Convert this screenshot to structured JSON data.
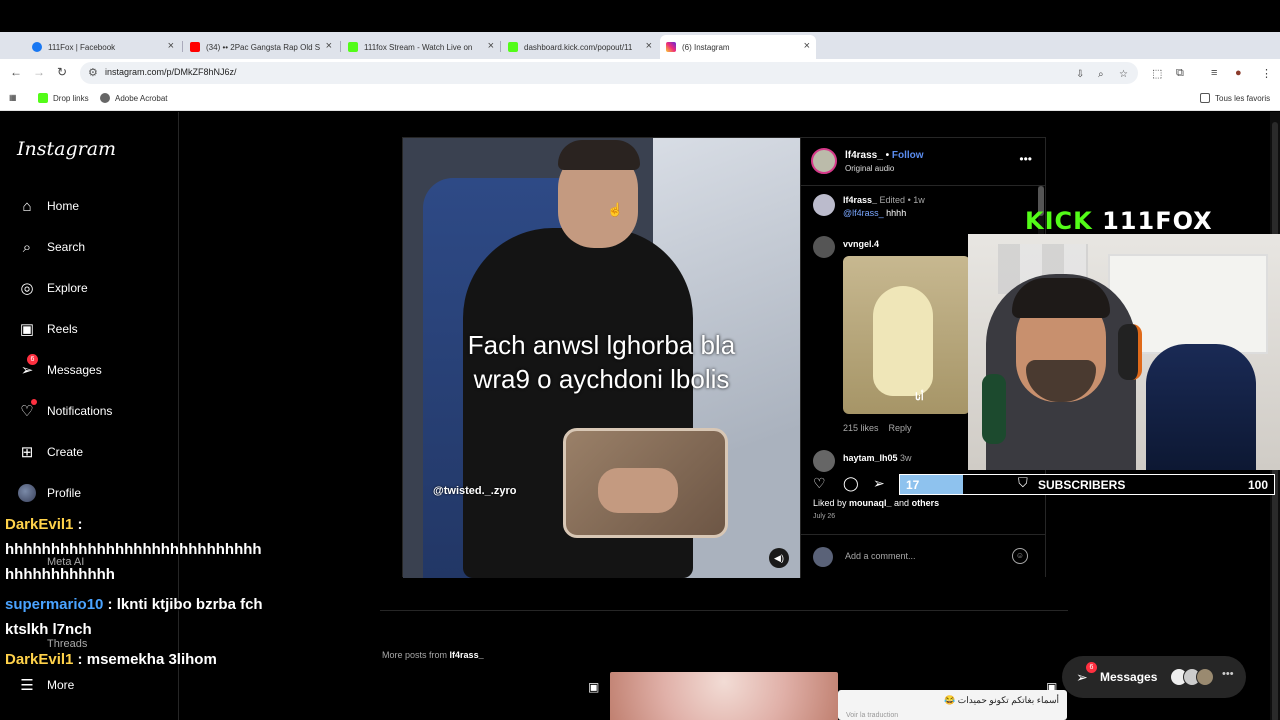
{
  "browser": {
    "tabs": [
      {
        "title": "111Fox | Facebook",
        "color": "#1877f2"
      },
      {
        "title": "(34) •• 2Pac Gangsta Rap Old S",
        "color": "#ff0000"
      },
      {
        "title": "111fox Stream - Watch Live on",
        "color": "#53fc18"
      },
      {
        "title": "dashboard.kick.com/popout/11",
        "color": "#53fc18"
      },
      {
        "title": "(6) Instagram",
        "color": "#d6249f"
      }
    ],
    "url": "instagram.com/p/DMkZF8hNJ6z/",
    "bookmarks": [
      {
        "label": "Drop links",
        "color": "#53fc18"
      },
      {
        "label": "Adobe Acrobat",
        "color": "#666666"
      }
    ],
    "all_bookmarks": "Tous les favoris"
  },
  "instagram": {
    "logo": "Instagram",
    "nav": [
      {
        "label": "Home",
        "icon": "home-icon"
      },
      {
        "label": "Search",
        "icon": "search-icon"
      },
      {
        "label": "Explore",
        "icon": "compass-icon"
      },
      {
        "label": "Reels",
        "icon": "reels-icon"
      },
      {
        "label": "Messages",
        "icon": "messenger-icon",
        "badge": "6"
      },
      {
        "label": "Notifications",
        "icon": "heart-icon"
      },
      {
        "label": "Create",
        "icon": "plus-square-icon"
      },
      {
        "label": "Profile",
        "icon": "avatar"
      }
    ],
    "nav_faint": {
      "meta_ai": "Meta AI",
      "threads": "Threads",
      "more": "More"
    },
    "post": {
      "caption_line1": "Fach anwsl lghorba bla",
      "caption_line2": "wra9 o aychdoni lbolis",
      "watermark": "@twisted._.zyro",
      "author": "lf4rass_",
      "follow": "Follow",
      "audio": "Original audio",
      "comments": [
        {
          "user": "lf4rass_",
          "meta": "Edited • 1w",
          "tag": "@lf4rass_",
          "text": "hhhh"
        },
        {
          "user": "vvngel.4",
          "gif_label": "أنا",
          "likes": "215 likes",
          "reply": "Reply"
        },
        {
          "user": "haytam_lh05",
          "meta": "3w"
        }
      ],
      "liked_by_user": "mounaql_",
      "liked_by_others": "others",
      "date": "July 26",
      "add_comment": "Add a comment..."
    },
    "more_posts_prefix": "More posts from",
    "more_posts_user": "lf4rass_",
    "notification_text": "أسماء بغاتكم تكونو حميدات 😂",
    "notification_sub": "Voir la traduction",
    "messages_pill": {
      "label": "Messages",
      "badge": "6"
    }
  },
  "stream": {
    "kick_word": "KICK",
    "channel": "111FOX",
    "subscribers": {
      "current": "17",
      "label": "SUBSCRIBERS",
      "goal": "100",
      "progress": 0.17
    },
    "chat": [
      {
        "user": "DarkEvil1",
        "message": "hhhhhhhhhhhhhhhhhhhhhhhhhhhh hhhhhhhhhhhh",
        "color": "yellow"
      },
      {
        "user": "supermario10",
        "message": "lknti ktjibo bzrba fch ktslkh l7nch",
        "color": "blue"
      },
      {
        "user": "DarkEvil1",
        "message": "msemekha 3lihom",
        "color": "yellow"
      }
    ]
  }
}
